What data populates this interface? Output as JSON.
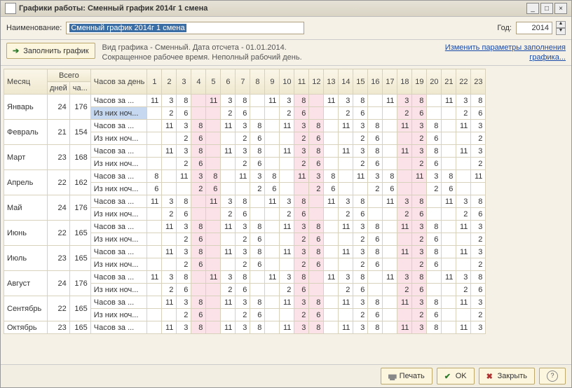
{
  "title": "Графики работы: Сменный график 2014г 1 смена",
  "labels": {
    "name": "Наименование:",
    "year": "Год:",
    "fill": "Заполнить график",
    "info1": "Вид графика - Сменный.  Дата отсчета - 01.01.2014.",
    "info2": "Сокращенное рабочее время. Неполный рабочий день.",
    "edit1": "Изменить параметры заполнения",
    "edit2": "графика...",
    "print": "Печать",
    "ok": "OK",
    "close": "Закрыть"
  },
  "input": {
    "name_value": "Сменный график 2014г 1 смена",
    "year": "2014"
  },
  "header": {
    "month": "Месяц",
    "total": "Всего",
    "days": "дней",
    "hours": "ча...",
    "hoursPerDay": "Часов за день"
  },
  "rowLabels": {
    "hours": "Часов за ...",
    "night": "Из них ноч..."
  },
  "days": [
    "1",
    "2",
    "3",
    "4",
    "5",
    "6",
    "7",
    "8",
    "9",
    "10",
    "11",
    "12",
    "13",
    "14",
    "15",
    "16",
    "17",
    "18",
    "19",
    "20",
    "21",
    "22",
    "23"
  ],
  "pinkCols": [
    4,
    5,
    11,
    12,
    18,
    19
  ],
  "months": [
    {
      "name": "Январь",
      "days": "24",
      "hours": "176",
      "h": [
        "11",
        "3",
        "8",
        "",
        "11",
        "3",
        "8",
        "",
        "11",
        "3",
        "8",
        "",
        "11",
        "3",
        "8",
        "",
        "11",
        "3",
        "8",
        "",
        "11",
        "3",
        "8"
      ],
      "n": [
        "",
        "2",
        "6",
        "",
        "",
        "2",
        "6",
        "",
        "",
        "2",
        "6",
        "",
        "",
        "2",
        "6",
        "",
        "",
        "2",
        "6",
        "",
        "",
        "2",
        "6"
      ],
      "hsel": false,
      "nsel": true
    },
    {
      "name": "Февраль",
      "days": "21",
      "hours": "154",
      "h": [
        "",
        "11",
        "3",
        "8",
        "",
        "11",
        "3",
        "8",
        "",
        "11",
        "3",
        "8",
        "",
        "11",
        "3",
        "8",
        "",
        "11",
        "3",
        "8",
        "",
        "11",
        "3"
      ],
      "n": [
        "",
        "",
        "2",
        "6",
        "",
        "",
        "2",
        "6",
        "",
        "",
        "2",
        "6",
        "",
        "",
        "2",
        "6",
        "",
        "",
        "2",
        "6",
        "",
        "",
        "2"
      ]
    },
    {
      "name": "Март",
      "days": "23",
      "hours": "168",
      "h": [
        "",
        "11",
        "3",
        "8",
        "",
        "11",
        "3",
        "8",
        "",
        "11",
        "3",
        "8",
        "",
        "11",
        "3",
        "8",
        "",
        "11",
        "3",
        "8",
        "",
        "11",
        "3"
      ],
      "n": [
        "",
        "",
        "2",
        "6",
        "",
        "",
        "2",
        "6",
        "",
        "",
        "2",
        "6",
        "",
        "",
        "2",
        "6",
        "",
        "",
        "2",
        "6",
        "",
        "",
        "2"
      ]
    },
    {
      "name": "Апрель",
      "days": "22",
      "hours": "162",
      "h": [
        "8",
        "",
        "11",
        "3",
        "8",
        "",
        "11",
        "3",
        "8",
        "",
        "11",
        "3",
        "8",
        "",
        "11",
        "3",
        "8",
        "",
        "11",
        "3",
        "8",
        "",
        "11"
      ],
      "n": [
        "6",
        "",
        "",
        "2",
        "6",
        "",
        "",
        "2",
        "6",
        "",
        "",
        "2",
        "6",
        "",
        "",
        "2",
        "6",
        "",
        "",
        "2",
        "6",
        "",
        ""
      ]
    },
    {
      "name": "Май",
      "days": "24",
      "hours": "176",
      "h": [
        "11",
        "3",
        "8",
        "",
        "11",
        "3",
        "8",
        "",
        "11",
        "3",
        "8",
        "",
        "11",
        "3",
        "8",
        "",
        "11",
        "3",
        "8",
        "",
        "11",
        "3",
        "8"
      ],
      "n": [
        "",
        "2",
        "6",
        "",
        "",
        "2",
        "6",
        "",
        "",
        "2",
        "6",
        "",
        "",
        "2",
        "6",
        "",
        "",
        "2",
        "6",
        "",
        "",
        "2",
        "6"
      ]
    },
    {
      "name": "Июнь",
      "days": "22",
      "hours": "165",
      "h": [
        "",
        "11",
        "3",
        "8",
        "",
        "11",
        "3",
        "8",
        "",
        "11",
        "3",
        "8",
        "",
        "11",
        "3",
        "8",
        "",
        "11",
        "3",
        "8",
        "",
        "11",
        "3"
      ],
      "n": [
        "",
        "",
        "2",
        "6",
        "",
        "",
        "2",
        "6",
        "",
        "",
        "2",
        "6",
        "",
        "",
        "2",
        "6",
        "",
        "",
        "2",
        "6",
        "",
        "",
        "2"
      ]
    },
    {
      "name": "Июль",
      "days": "23",
      "hours": "165",
      "h": [
        "",
        "11",
        "3",
        "8",
        "",
        "11",
        "3",
        "8",
        "",
        "11",
        "3",
        "8",
        "",
        "11",
        "3",
        "8",
        "",
        "11",
        "3",
        "8",
        "",
        "11",
        "3"
      ],
      "n": [
        "",
        "",
        "2",
        "6",
        "",
        "",
        "2",
        "6",
        "",
        "",
        "2",
        "6",
        "",
        "",
        "2",
        "6",
        "",
        "",
        "2",
        "6",
        "",
        "",
        "2"
      ]
    },
    {
      "name": "Август",
      "days": "24",
      "hours": "176",
      "h": [
        "11",
        "3",
        "8",
        "",
        "11",
        "3",
        "8",
        "",
        "11",
        "3",
        "8",
        "",
        "11",
        "3",
        "8",
        "",
        "11",
        "3",
        "8",
        "",
        "11",
        "3",
        "8"
      ],
      "n": [
        "",
        "2",
        "6",
        "",
        "",
        "2",
        "6",
        "",
        "",
        "2",
        "6",
        "",
        "",
        "2",
        "6",
        "",
        "",
        "2",
        "6",
        "",
        "",
        "2",
        "6"
      ]
    },
    {
      "name": "Сентябрь",
      "days": "22",
      "hours": "165",
      "h": [
        "",
        "11",
        "3",
        "8",
        "",
        "11",
        "3",
        "8",
        "",
        "11",
        "3",
        "8",
        "",
        "11",
        "3",
        "8",
        "",
        "11",
        "3",
        "8",
        "",
        "11",
        "3"
      ],
      "n": [
        "",
        "",
        "2",
        "6",
        "",
        "",
        "2",
        "6",
        "",
        "",
        "2",
        "6",
        "",
        "",
        "2",
        "6",
        "",
        "",
        "2",
        "6",
        "",
        "",
        "2"
      ]
    },
    {
      "name": "Октябрь",
      "days": "23",
      "hours": "165",
      "h": [
        "",
        "11",
        "3",
        "8",
        "",
        "11",
        "3",
        "8",
        "",
        "11",
        "3",
        "8",
        "",
        "11",
        "3",
        "8",
        "",
        "11",
        "3",
        "8",
        "",
        "11",
        "3"
      ]
    }
  ]
}
